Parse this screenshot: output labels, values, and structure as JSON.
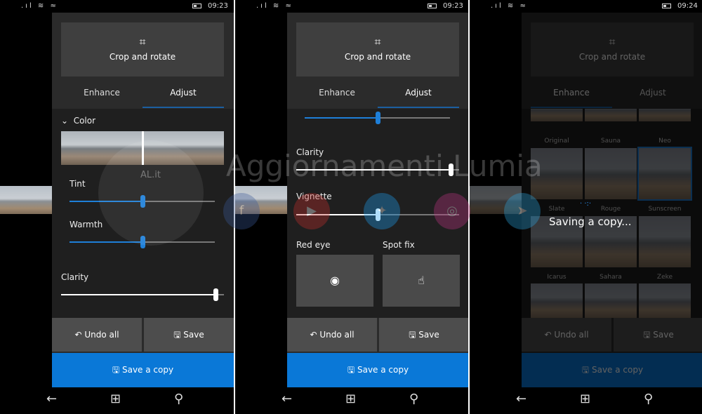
{
  "status": [
    {
      "time": "09:23"
    },
    {
      "time": "09:23"
    },
    {
      "time": "09:24"
    }
  ],
  "crop_label": "Crop and rotate",
  "tabs": {
    "enhance": "Enhance",
    "adjust": "Adjust"
  },
  "buttons": {
    "undo_all": "Undo all",
    "save": "Save",
    "save_copy": "Save a copy"
  },
  "panel1": {
    "section": "Color",
    "tint": {
      "label": "Tint",
      "value": 0.5
    },
    "warmth": {
      "label": "Warmth",
      "value": 0.5
    },
    "clarity": {
      "label": "Clarity",
      "value": 0.95
    }
  },
  "panel2": {
    "top_slider_value": 0.5,
    "clarity": {
      "label": "Clarity",
      "value": 0.95
    },
    "vignette": {
      "label": "Vignette",
      "value": 0.5
    },
    "red_eye": "Red eye",
    "spot_fix": "Spot fix"
  },
  "panel3": {
    "filters": [
      "Original",
      "Sauna",
      "Neo",
      "Slate",
      "Rouge",
      "Sunscreen",
      "Icarus",
      "Sahara",
      "Zeke"
    ],
    "selected": "Sunscreen",
    "overlay": "Saving a copy..."
  },
  "watermark": {
    "text": "Aggiornamenti Lumia",
    "logo": "AL.it"
  },
  "colors": {
    "accent": "#0a78d7",
    "app_bg": "#2b2b2b",
    "list_bg": "#1f1f1f"
  }
}
